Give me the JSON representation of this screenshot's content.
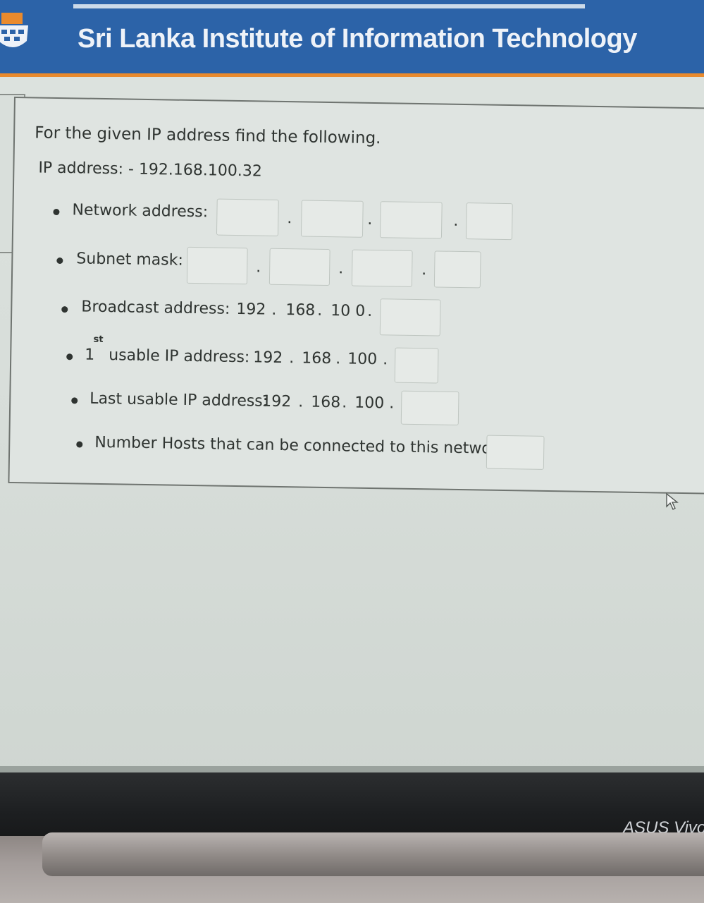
{
  "header": {
    "title": "Sri Lanka Institute of Information Technology"
  },
  "question": {
    "instruction": "For the given IP address find the following.",
    "ip_line": "IP address: - 192.168.100.32"
  },
  "fields": {
    "network_address": {
      "label": "Network address:"
    },
    "subnet_mask": {
      "label": "Subnet mask:"
    },
    "broadcast": {
      "label": "Broadcast address:",
      "o1": "192",
      "o2": "168",
      "o3": "10 0"
    },
    "first_usable": {
      "prefix": "1",
      "sup": "st",
      "label": "usable IP address:",
      "o1": "192",
      "o2": "168",
      "o3": "100"
    },
    "last_usable": {
      "label": "Last usable IP address:",
      "o1": "192",
      "o2": "168",
      "o3": "100"
    },
    "hosts": {
      "label": "Number Hosts that can be connected to this network:"
    }
  },
  "separator": ".",
  "device": {
    "brand": "ASUS Vivo"
  },
  "colors": {
    "header_blue": "#2c63a8",
    "header_orange": "#e98a2d"
  },
  "icons": {
    "cursor": "mouse-pointer-icon",
    "logo": "sliit-logo-icon"
  }
}
